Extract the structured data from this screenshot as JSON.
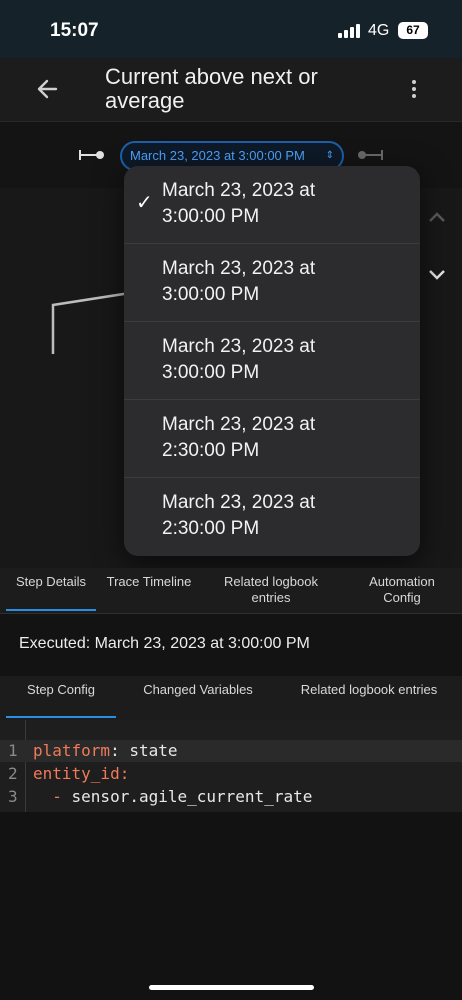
{
  "status": {
    "time": "15:07",
    "network": "4G",
    "battery": "67"
  },
  "header": {
    "title": "Current above next or average"
  },
  "trace": {
    "selected": "March 23, 2023 at 3:00:00 PM"
  },
  "dropdown": {
    "options": [
      {
        "label": "March 23, 2023 at 3:00:00 PM",
        "checked": true
      },
      {
        "label": "March 23, 2023 at 3:00:00 PM",
        "checked": false
      },
      {
        "label": "March 23, 2023 at 3:00:00 PM",
        "checked": false
      },
      {
        "label": "March 23, 2023 at 2:30:00 PM",
        "checked": false
      },
      {
        "label": "March 23, 2023 at 2:30:00 PM",
        "checked": false
      }
    ],
    "check_glyph": "✓"
  },
  "tabs": [
    {
      "label": "Step Details",
      "active": true
    },
    {
      "label": "Trace Timeline",
      "active": false
    },
    {
      "label": "Related logbook entries",
      "active": false
    },
    {
      "label": "Automation Config",
      "active": false
    }
  ],
  "executed": {
    "text": "Executed: March 23, 2023 at 3:00:00 PM"
  },
  "subtabs": [
    {
      "label": "Step Config",
      "active": true
    },
    {
      "label": "Changed Variables",
      "active": false
    },
    {
      "label": "Related logbook entries",
      "active": false
    }
  ],
  "code": {
    "lines": [
      {
        "no": "1",
        "key": "platform",
        "sep": ": ",
        "value": "state"
      },
      {
        "no": "2",
        "key": "entity_id",
        "sep": ":",
        "value": ""
      },
      {
        "no": "3",
        "indent": "  ",
        "dash": "- ",
        "value": "sensor.agile_current_rate"
      }
    ]
  },
  "colors": {
    "accent": "#2a8ee6",
    "select_text": "#4da3ff",
    "yaml_key": "#f07a5a"
  },
  "icons": {
    "back": "arrow-left-icon",
    "menu": "dots-vertical-icon",
    "prev": "trace-prev-icon",
    "next": "trace-next-icon",
    "up": "chevron-up-icon",
    "down": "chevron-down-icon"
  }
}
